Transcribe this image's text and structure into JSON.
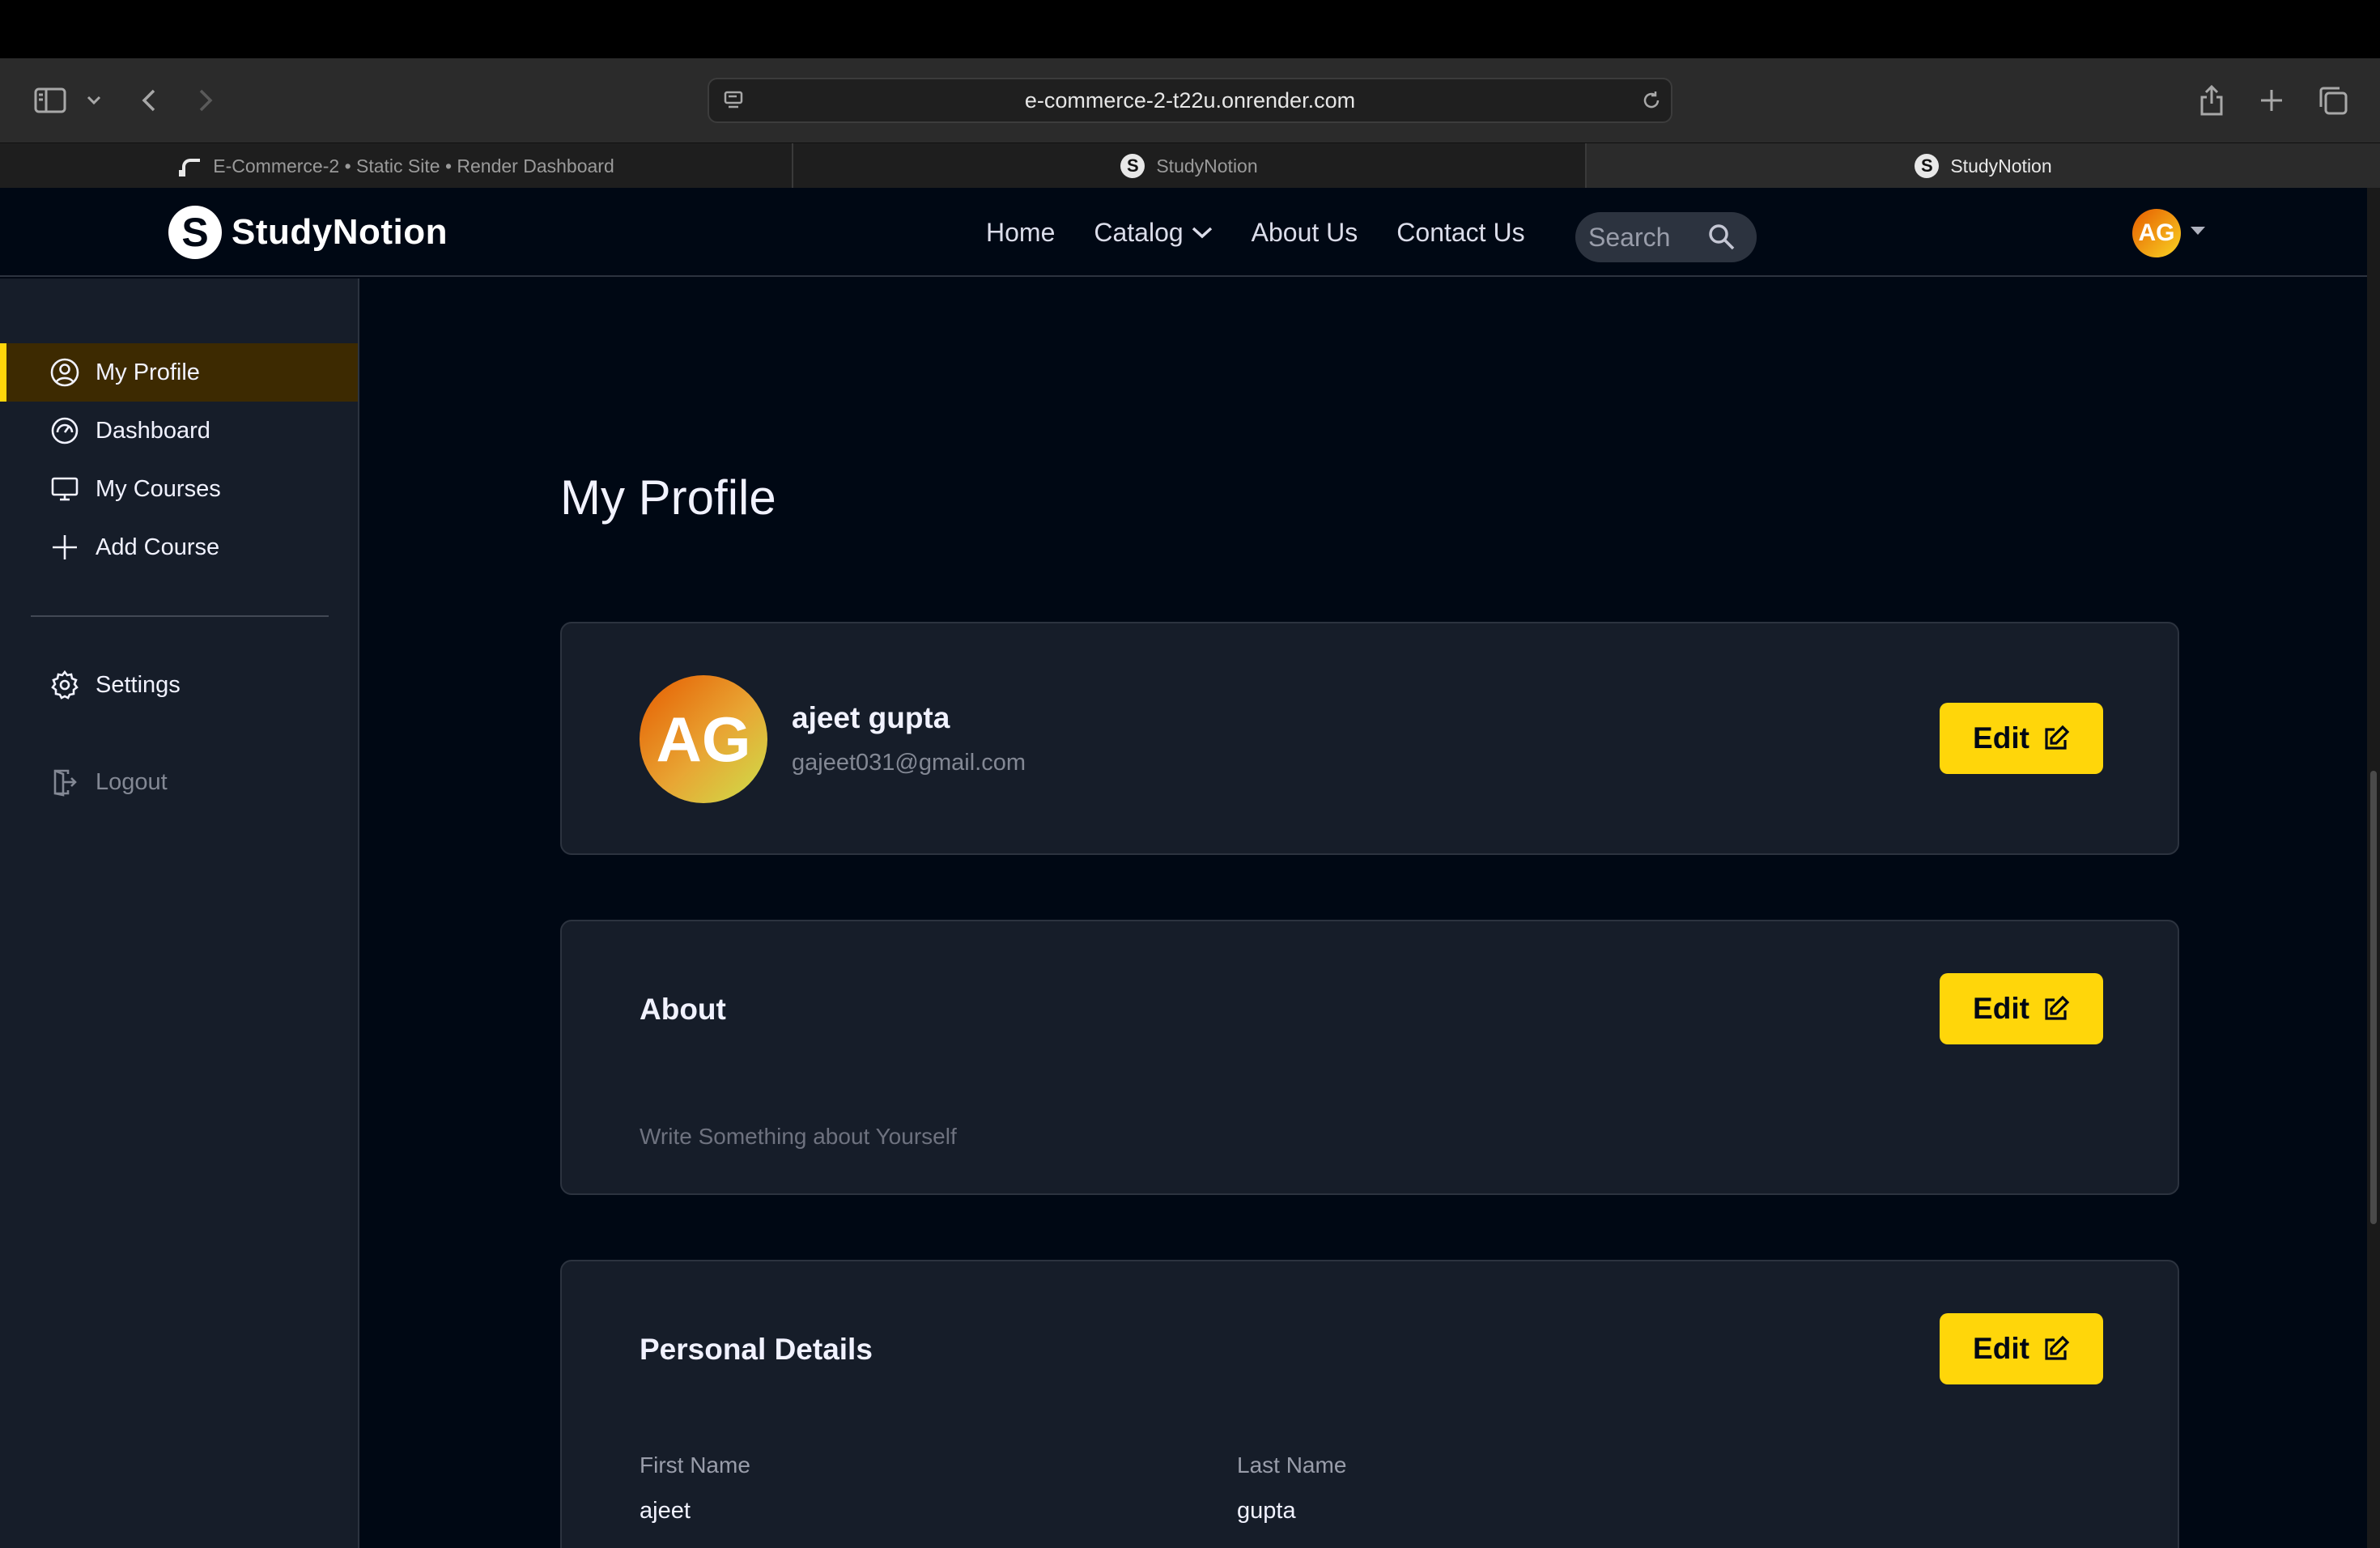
{
  "browser": {
    "url": "e-commerce-2-t22u.onrender.com",
    "tabs": [
      {
        "label": "E-Commerce-2 • Static Site • Render Dashboard",
        "active": false
      },
      {
        "label": "StudyNotion",
        "active": false
      },
      {
        "label": "StudyNotion",
        "active": true
      }
    ]
  },
  "navbar": {
    "logo_mark": "S",
    "logo_text": "StudyNotion",
    "links": [
      "Home",
      "Catalog",
      "About Us",
      "Contact Us"
    ],
    "search_placeholder": "Search",
    "avatar_initials": "AG"
  },
  "sidebar": {
    "items": [
      {
        "label": "My Profile",
        "icon": "user-circle-icon",
        "active": true
      },
      {
        "label": "Dashboard",
        "icon": "gauge-icon"
      },
      {
        "label": "My Courses",
        "icon": "monitor-icon"
      },
      {
        "label": "Add Course",
        "icon": "plus-icon"
      }
    ],
    "settings_label": "Settings",
    "logout_label": "Logout"
  },
  "main": {
    "title": "My Profile",
    "profile": {
      "initials": "AG",
      "name": "ajeet gupta",
      "email": "gajeet031@gmail.com",
      "edit_label": "Edit"
    },
    "about": {
      "heading": "About",
      "placeholder_text": "Write Something about Yourself",
      "edit_label": "Edit"
    },
    "personal_details": {
      "heading": "Personal Details",
      "edit_label": "Edit",
      "fields": [
        {
          "label": "First Name",
          "value": "ajeet"
        },
        {
          "label": "Last Name",
          "value": "gupta"
        }
      ]
    }
  },
  "colors": {
    "accent": "#FFD60A",
    "background": "#000814",
    "card": "#161D29",
    "border": "#2C333F",
    "active_sidebar": "#3D2A01"
  }
}
